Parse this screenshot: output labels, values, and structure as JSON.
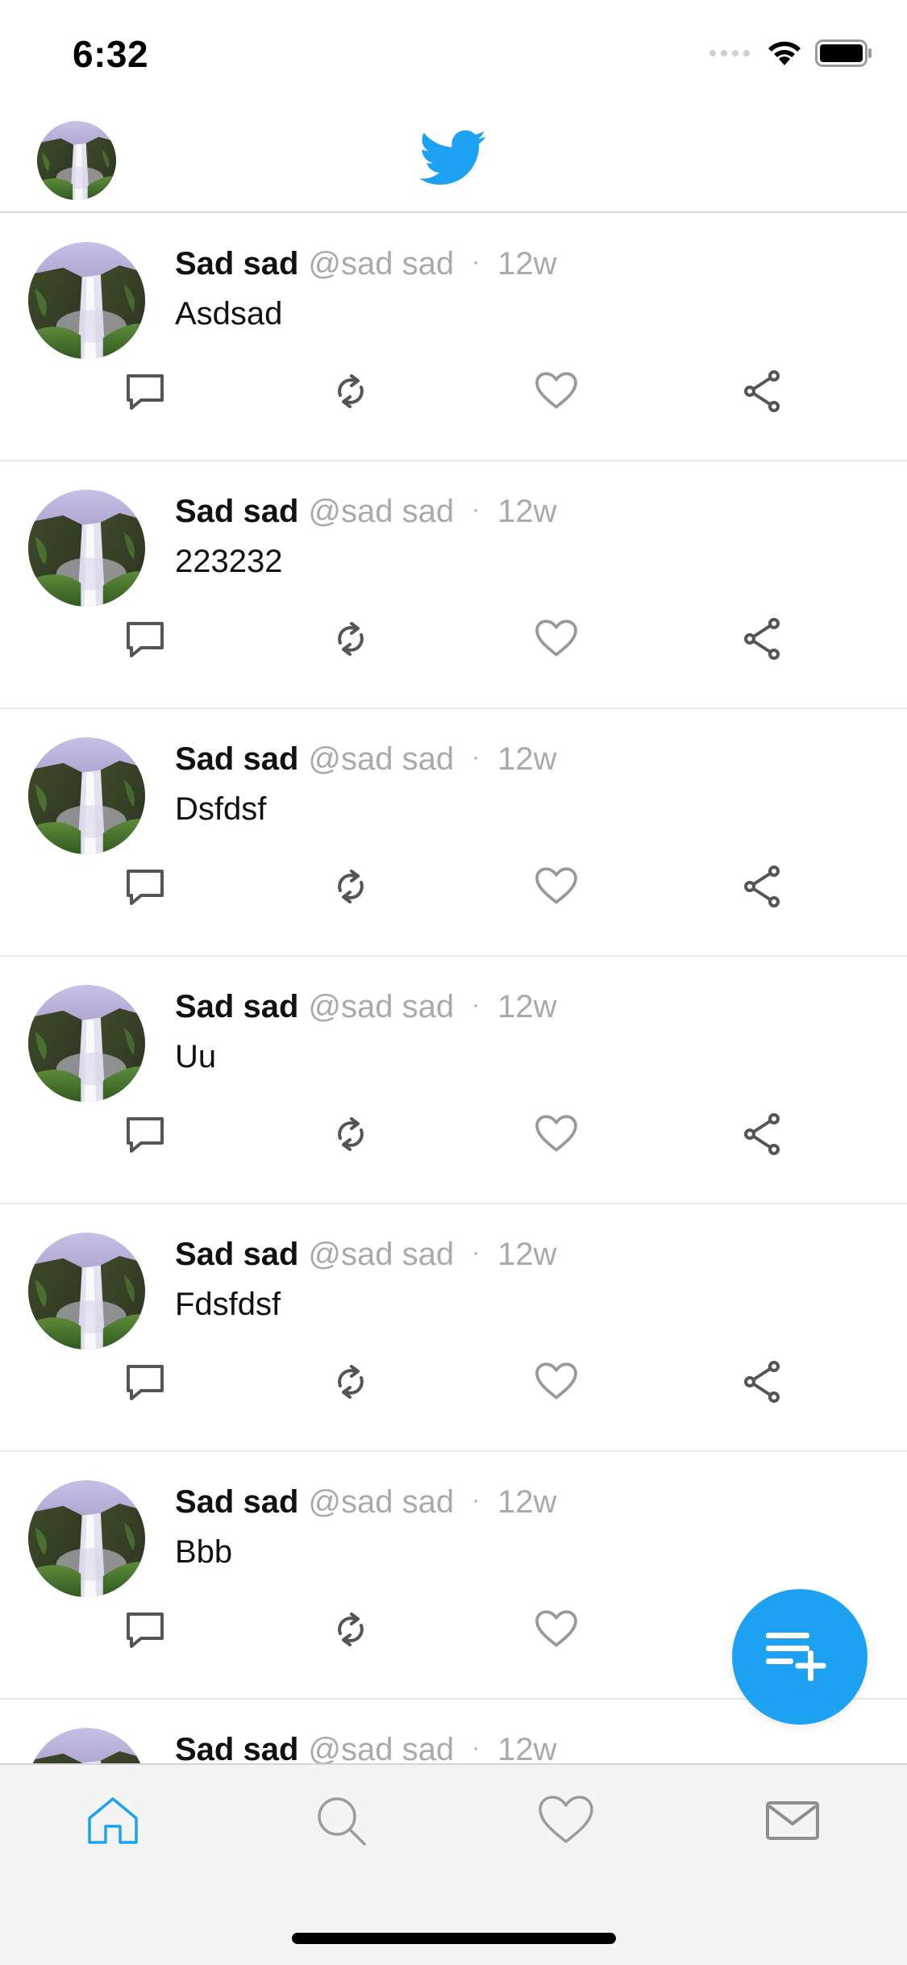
{
  "status_bar": {
    "time": "6:32",
    "signal_icon": "signal-dots-icon",
    "wifi_icon": "wifi-icon",
    "battery_icon": "battery-icon"
  },
  "header": {
    "avatar_icon": "profile-avatar",
    "logo_icon": "twitter-bird-icon",
    "logo_color": "#1da1f2"
  },
  "feed": {
    "tweets": [
      {
        "name": "Sad sad",
        "handle": "@sad sad",
        "dot": "·",
        "time": "12w",
        "text": "Asdsad"
      },
      {
        "name": "Sad sad",
        "handle": "@sad sad",
        "dot": "·",
        "time": "12w",
        "text": "223232"
      },
      {
        "name": "Sad sad",
        "handle": "@sad sad",
        "dot": "·",
        "time": "12w",
        "text": "Dsfdsf"
      },
      {
        "name": "Sad sad",
        "handle": "@sad sad",
        "dot": "·",
        "time": "12w",
        "text": "Uu"
      },
      {
        "name": "Sad sad",
        "handle": "@sad sad",
        "dot": "·",
        "time": "12w",
        "text": "Fdsfdsf"
      },
      {
        "name": "Sad sad",
        "handle": "@sad sad",
        "dot": "·",
        "time": "12w",
        "text": "Bbb"
      },
      {
        "name": "Sad sad",
        "handle": "@sad sad",
        "dot": "·",
        "time": "12w",
        "text": ""
      }
    ],
    "action_icons": [
      "reply-icon",
      "retweet-icon",
      "like-icon",
      "share-icon"
    ]
  },
  "fab": {
    "icon": "compose-tweet-icon",
    "color": "#1da1f2"
  },
  "tab_bar": {
    "tabs": [
      {
        "icon": "home-icon",
        "active": true
      },
      {
        "icon": "search-icon",
        "active": false
      },
      {
        "icon": "heart-icon",
        "active": false
      },
      {
        "icon": "mail-icon",
        "active": false
      }
    ],
    "active_color": "#1da1f2",
    "inactive_color": "#9b9b9b"
  }
}
